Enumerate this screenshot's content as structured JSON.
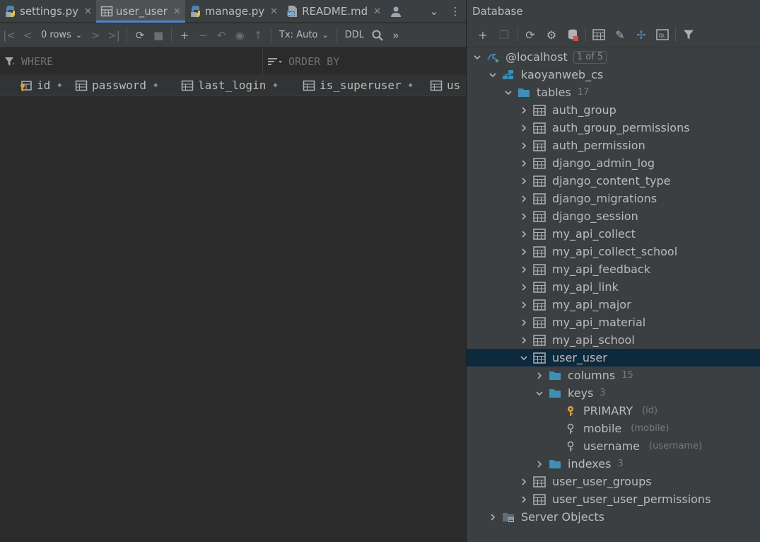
{
  "tabs": [
    {
      "label": "settings.py",
      "icon": "python-file-icon",
      "active": false
    },
    {
      "label": "user_user",
      "icon": "table-icon",
      "active": true
    },
    {
      "label": "manage.py",
      "icon": "python-file-icon",
      "active": false
    },
    {
      "label": "README.md",
      "icon": "markdown-file-icon",
      "active": false
    }
  ],
  "toolbar": {
    "rows_label": "0 rows",
    "tx_label": "Tx: Auto",
    "ddl_label": "DDL"
  },
  "filter": {
    "where_placeholder": "WHERE",
    "orderby_placeholder": "ORDER BY"
  },
  "columns": [
    {
      "name": "id",
      "icon": "primary-key-column-icon"
    },
    {
      "name": "password",
      "icon": "column-icon"
    },
    {
      "name": "last_login",
      "icon": "column-icon"
    },
    {
      "name": "is_superuser",
      "icon": "column-icon"
    },
    {
      "name": "us",
      "icon": "column-icon"
    }
  ],
  "db_panel": {
    "title": "Database",
    "host": "@localhost",
    "host_badge": "1 of 5",
    "schema": "kaoyanweb_cs",
    "tables_label": "tables",
    "tables_count": "17",
    "tables": [
      "auth_group",
      "auth_group_permissions",
      "auth_permission",
      "django_admin_log",
      "django_content_type",
      "django_migrations",
      "django_session",
      "my_api_collect",
      "my_api_collect_school",
      "my_api_feedback",
      "my_api_link",
      "my_api_major",
      "my_api_material",
      "my_api_school"
    ],
    "selected_table": "user_user",
    "columns_label": "columns",
    "columns_count": "15",
    "keys_label": "keys",
    "keys_count": "3",
    "keys": [
      {
        "name": "PRIMARY",
        "hint": "(id)",
        "primary": true
      },
      {
        "name": "mobile",
        "hint": "(mobile)",
        "primary": false
      },
      {
        "name": "username",
        "hint": "(username)",
        "primary": false
      }
    ],
    "indexes_label": "indexes",
    "indexes_count": "3",
    "tables_after": [
      "user_user_groups",
      "user_user_user_permissions"
    ],
    "server_objects": "Server Objects"
  },
  "colors": {
    "accent": "#4a88c7",
    "selection": "#0d293e",
    "folder": "#3d8fb6",
    "key_gold": "#d9a343"
  }
}
